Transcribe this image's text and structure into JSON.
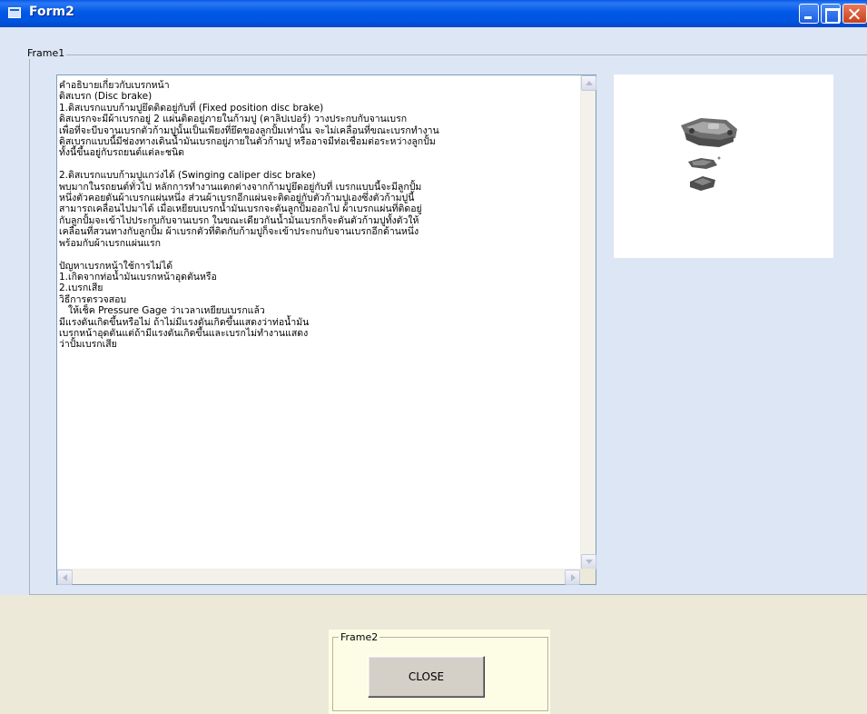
{
  "window": {
    "title": "Form2"
  },
  "frame1": {
    "label": "Frame1",
    "text_lines": [
      "คำอธิบายเกี่ยวกับเบรกหน้า",
      "ดิสเบรก (Disc brake)",
      "1.ดิสเบรกแบบก้ามปูยึดติดอยู่กับที่ (Fixed position disc brake)",
      "ดิสเบรกจะมีผ้าเบรกอยู่ 2 แผ่นติดอยู่ภายในก้ามปู (คาลิปเปอร์) วางประกบกับจานเบรก",
      "เพื่อที่จะบีบจานเบรกตัวก้ามปูนั้นเป็นเพียงที่ยึดของลูกปั้มเท่านั้น จะไม่เคลื่อนที่ขณะเบรกทำงาน",
      "ดิสเบรกแบบนี้มีช่องทางเดินน้ำมันเบรกอยู่ภายในตัวก้ามปู หรืออาจมีท่อเชื่อมต่อระหว่างลูกปั้ม",
      "ทั้งนี้ขึ้นอยู่กับรถยนต์แต่ละชนิด",
      "",
      "2.ดิสเบรกแบบก้ามปูแกว่งได้ (Swinging caliper disc brake)",
      "พบมากในรถยนต์ทั่วไป หลักการทำงานแตกต่างจากก้ามปูยึดอยู่กับที่ เบรกแบบนี้จะมีลูกปั้ม",
      "หนึ่งตัวคอยดันผ้าเบรกแผ่นหนึ่ง ส่วนผ้าเบรกอีกแผ่นจะติดอยู่กับตัวก้ามปูเองซึ่งตัวก้ามปูนี้",
      "สามารถเคลื่อนไปมาได้ เมื่อเหยียบเบรกน้ำมันเบรกจะดันลูกปั้มออกไป ผ้าเบรกแผ่นที่ติดอยู่",
      "กับลูกปั้มจะเข้าไปประกบกับจานเบรก ในขณะเดียวกันน้ำมันเบรกก็จะดันตัวก้ามปูทั้งตัวให้",
      "เคลื่อนที่สวนทางกับลูกปั้ม ผ้าเบรกตัวที่ติดกับก้ามปูก็จะเข้าประกบกับจานเบรกอีกด้านหนึ่ง",
      "พร้อมกับผ้าเบรกแผ่นแรก",
      "",
      "ปัญหาเบรกหน้าใช้การไม่ได้",
      "1.เกิดจากท่อน้ำมันเบรกหน้าอุดตันหรือ",
      "2.เบรกเสีย",
      "วิธีการตรวจสอบ",
      "   ให้เช็ค Pressure Gage ว่าเวลาเหยียบเบรกแล้ว",
      "มีแรงดันเกิดขึ้นหรือไม่ ถ้าไม่มีแรงดันเกิดขึ้นแสดงว่าท่อน้ำมัน",
      "เบรกหน้าอุดตันแต่ถ้ามีแรงดันเกิดขึ้นและเบรกไม่ทำงานแสดง",
      "ว่าปั้มเบรกเสีย"
    ]
  },
  "picture": {
    "subject": "disc-brake-caliper-image"
  },
  "frame2": {
    "label": "Frame2",
    "close_label": "CLOSE"
  },
  "colors": {
    "titlebar": "#0058e6",
    "frame1_bg": "#dce6f4",
    "frame2_bg": "#fdfde6",
    "client_bg": "#ece9d8"
  }
}
